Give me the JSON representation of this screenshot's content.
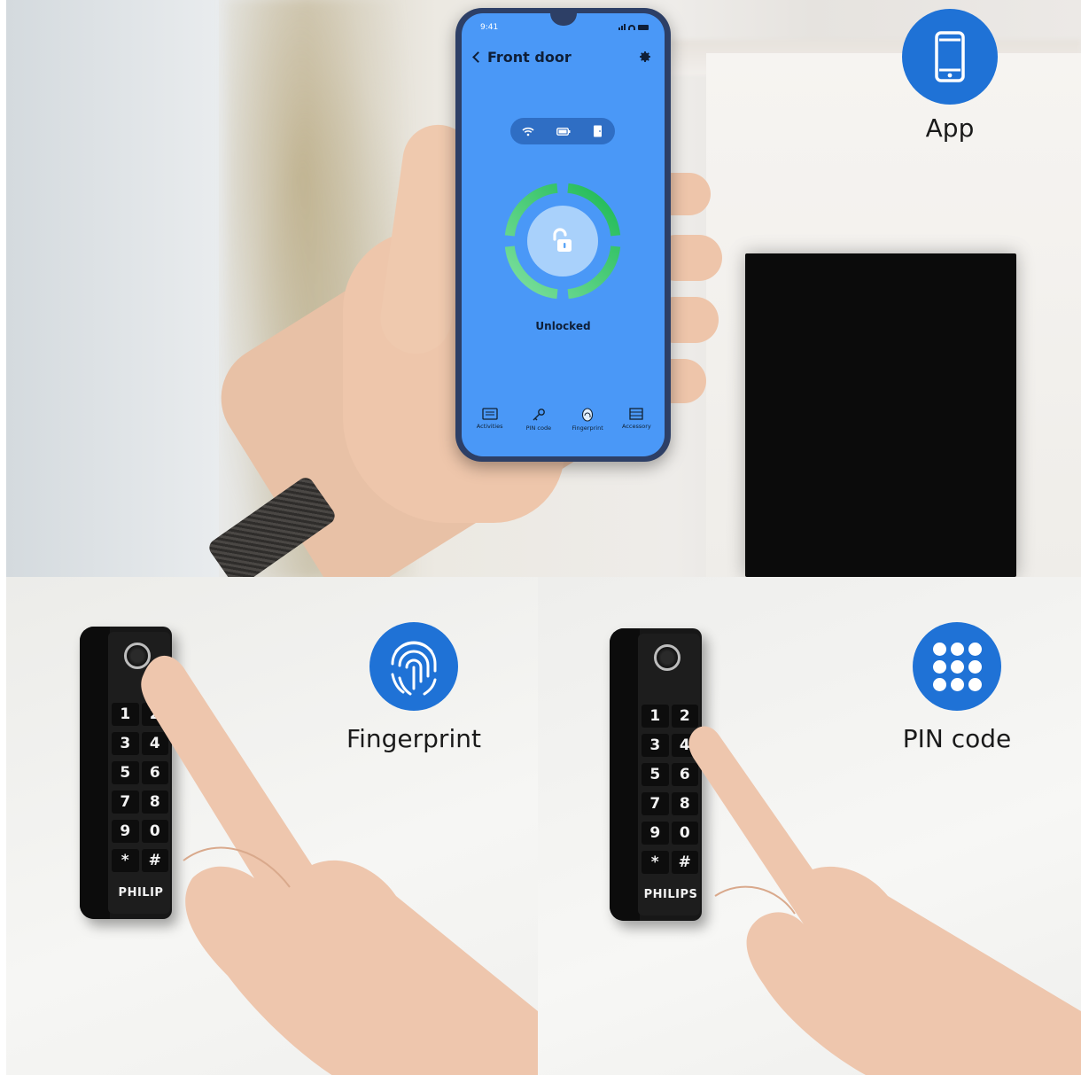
{
  "app_panel": {
    "phone": {
      "status_time": "9:41",
      "title": "Front door",
      "lock_status": "Unlocked",
      "tabs": [
        {
          "label": "Activities",
          "icon": "folder-icon"
        },
        {
          "label": "PIN code",
          "icon": "key-icon"
        },
        {
          "label": "Fingerprint",
          "icon": "fingerprint-icon"
        },
        {
          "label": "Accessory",
          "icon": "list-icon"
        }
      ],
      "status_pill_icons": [
        "wifi-icon",
        "battery-icon",
        "door-icon"
      ],
      "screen_color": "#4a98f7",
      "ring_color": "#2ecc71"
    },
    "badge_label": "App",
    "badge_icon": "smartphone-icon"
  },
  "fingerprint_panel": {
    "badge_label": "Fingerprint",
    "badge_icon": "fingerprint-icon",
    "keypad_keys": [
      "1",
      "2",
      "3",
      "4",
      "5",
      "6",
      "7",
      "8",
      "9",
      "0",
      "*",
      "#"
    ],
    "brand": "PHILIP"
  },
  "pin_panel": {
    "badge_label": "PIN code",
    "badge_icon": "keypad-dots-icon",
    "keypad_keys": [
      "1",
      "2",
      "3",
      "4",
      "5",
      "6",
      "7",
      "8",
      "9",
      "0",
      "*",
      "#"
    ],
    "brand": "PHILIPS"
  },
  "colors": {
    "badge_blue": "#1f72d6",
    "app_screen": "#4a98f7"
  }
}
